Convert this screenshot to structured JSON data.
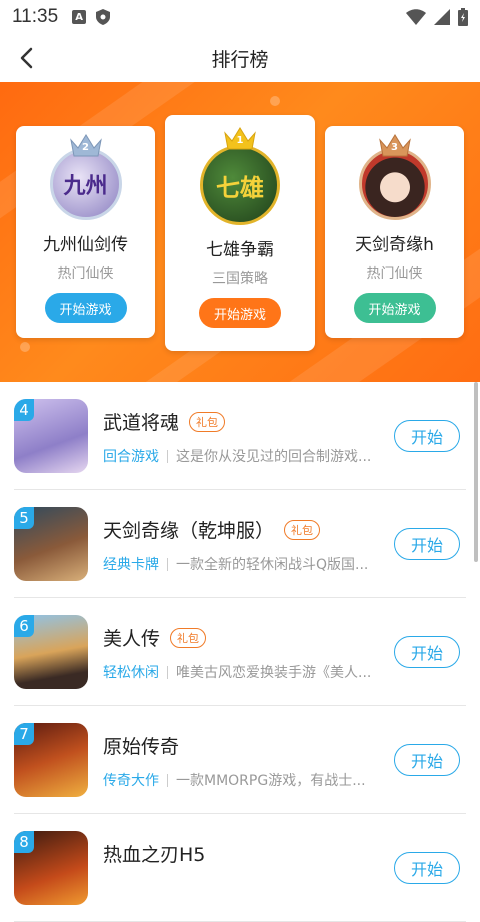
{
  "status_bar": {
    "time": "11:35",
    "left_icons": [
      "a-icon",
      "shield-icon"
    ],
    "right_icons": [
      "wifi-icon",
      "signal-icon",
      "battery-icon"
    ]
  },
  "header": {
    "title": "排行榜"
  },
  "colors": {
    "accent": "#2aa9e8",
    "orange": "#ff7518",
    "green": "#3dbf93",
    "gift": "#f07b28"
  },
  "top3": [
    {
      "rank": "2",
      "name": "九州仙剑传",
      "category": "热门仙侠",
      "button": "开始游戏",
      "button_color": "#2aa9e8",
      "avatar_text": "九州"
    },
    {
      "rank": "1",
      "name": "七雄争霸",
      "category": "三国策略",
      "button": "开始游戏",
      "button_color": "#ff7518",
      "avatar_text": "七雄"
    },
    {
      "rank": "3",
      "name": "天剑奇缘h",
      "category": "热门仙侠",
      "button": "开始游戏",
      "button_color": "#3dbf93",
      "avatar_text": ""
    }
  ],
  "list": [
    {
      "rank": "4",
      "name": "武道将魂",
      "gift": "礼包",
      "tag": "回合游戏",
      "desc": "这是你从没见过的回合制游戏...",
      "button": "开始"
    },
    {
      "rank": "5",
      "name": "天剑奇缘（乾坤服）",
      "gift": "礼包",
      "tag": "经典卡牌",
      "desc": "一款全新的轻休闲战斗Q版国...",
      "button": "开始"
    },
    {
      "rank": "6",
      "name": "美人传",
      "gift": "礼包",
      "tag": "轻松休闲",
      "desc": "唯美古风恋爱换装手游《美人...",
      "button": "开始"
    },
    {
      "rank": "7",
      "name": "原始传奇",
      "gift": "",
      "tag": "传奇大作",
      "desc": "一款MMORPG游戏，有战士...",
      "button": "开始"
    },
    {
      "rank": "8",
      "name": "热血之刃H5",
      "gift": "",
      "tag": "",
      "desc": "",
      "button": "开始"
    }
  ]
}
